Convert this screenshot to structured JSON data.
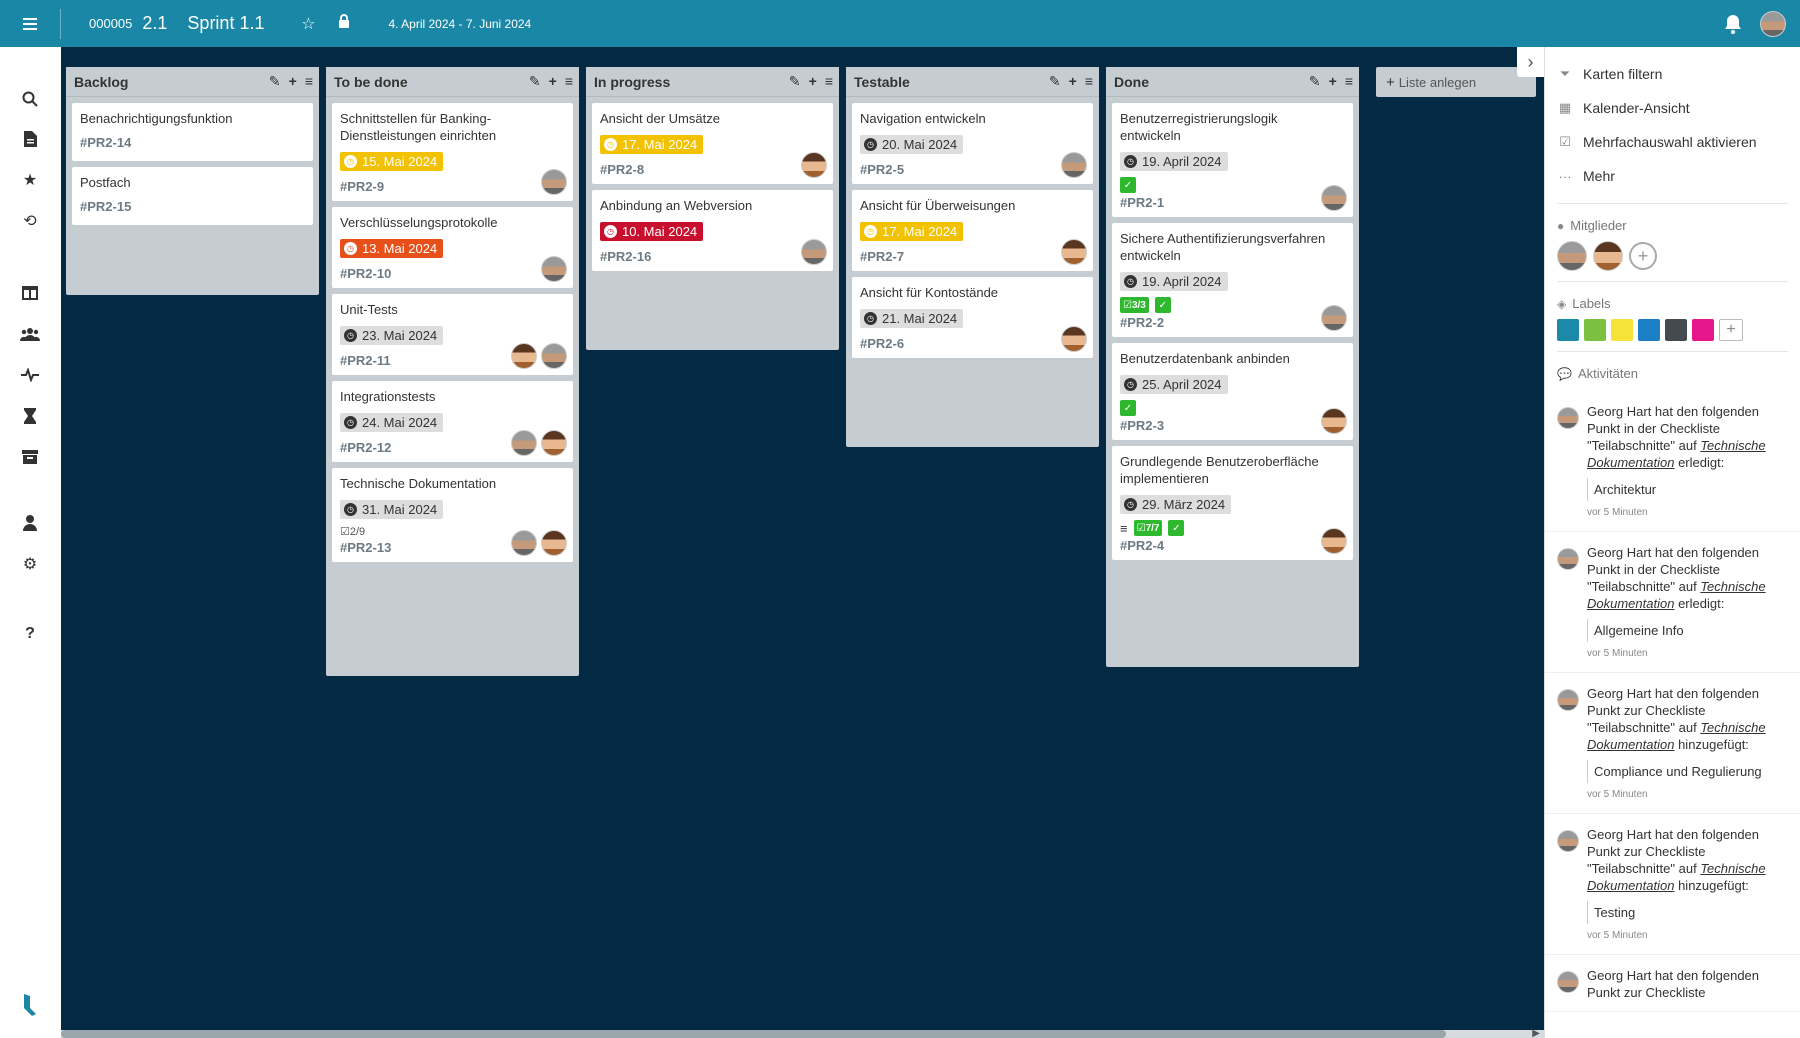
{
  "header": {
    "project_id": "000005",
    "project_version": "2.1",
    "sprint_name": "Sprint 1.1",
    "date_range": "4. April 2024 - 7. Juni 2024"
  },
  "columns": [
    {
      "title": "Backlog",
      "cards": [
        {
          "title": "Benachrichtigungsfunktion",
          "id": "#PR2-14"
        },
        {
          "title": "Postfach",
          "id": "#PR2-15"
        }
      ]
    },
    {
      "title": "To be done",
      "cards": [
        {
          "title": "Schnittstellen für Banking-Dienstleistungen einrichten",
          "date": "15. Mai 2024",
          "id": "#PR2-9"
        },
        {
          "title": "Verschlüsselungsprotokolle",
          "date": "13. Mai 2024",
          "id": "#PR2-10"
        },
        {
          "title": "Unit-Tests",
          "date": "23. Mai 2024",
          "id": "#PR2-11"
        },
        {
          "title": "Integrationstests",
          "date": "24. Mai 2024",
          "id": "#PR2-12"
        },
        {
          "title": "Technische Dokumentation",
          "date": "31. Mai 2024",
          "checklist": "2/9",
          "id": "#PR2-13"
        }
      ]
    },
    {
      "title": "In progress",
      "cards": [
        {
          "title": "Ansicht der Umsätze",
          "date": "17. Mai 2024",
          "id": "#PR2-8"
        },
        {
          "title": "Anbindung an Webversion",
          "date": "10. Mai 2024",
          "id": "#PR2-16"
        }
      ]
    },
    {
      "title": "Testable",
      "cards": [
        {
          "title": "Navigation entwickeln",
          "date": "20. Mai 2024",
          "id": "#PR2-5"
        },
        {
          "title": "Ansicht für Überweisungen",
          "date": "17. Mai 2024",
          "id": "#PR2-7"
        },
        {
          "title": "Ansicht für Kontostände",
          "date": "21. Mai 2024",
          "id": "#PR2-6"
        }
      ]
    },
    {
      "title": "Done",
      "cards": [
        {
          "title": "Benutzerregistrierungslogik entwickeln",
          "date": "19. April 2024",
          "id": "#PR2-1"
        },
        {
          "title": "Sichere Authentifizierungsverfahren entwickeln",
          "date": "19. April 2024",
          "checklist": "3/3",
          "id": "#PR2-2"
        },
        {
          "title": "Benutzerdatenbank anbinden",
          "date": "25. April 2024",
          "id": "#PR2-3"
        },
        {
          "title": "Grundlegende Benutzeroberfläche implementieren",
          "date": "29. März 2024",
          "checklist": "7/7",
          "id": "#PR2-4"
        }
      ]
    }
  ],
  "add_list_label": "Liste anlegen",
  "right_panel": {
    "menu": [
      {
        "label": "Karten filtern",
        "icon": "filter-icon"
      },
      {
        "label": "Kalender-Ansicht",
        "icon": "calendar-icon"
      },
      {
        "label": "Mehrfachauswahl aktivieren",
        "icon": "checkbox-icon"
      },
      {
        "label": "Mehr",
        "icon": "more-icon"
      }
    ],
    "members_title": "Mitglieder",
    "labels_title": "Labels",
    "label_colors": [
      "#1a8aa8",
      "#7ac142",
      "#f5e33a",
      "#1a7fc4",
      "#444b50",
      "#e8168c"
    ],
    "activities_title": "Aktivitäten",
    "activities": [
      {
        "line1": "Georg Hart hat den folgenden Punkt in der Checkliste \"Teilabschnitte\" auf",
        "link": "Technische Dokumentation",
        "verb": "erledigt:",
        "item": "Architektur",
        "time": "vor 5 Minuten"
      },
      {
        "line1": "Georg Hart hat den folgenden Punkt in der Checkliste \"Teilabschnitte\" auf",
        "link": "Technische Dokumentation",
        "verb": "erledigt:",
        "item": "Allgemeine Info",
        "time": "vor 5 Minuten"
      },
      {
        "line1": "Georg Hart hat den folgenden Punkt zur Checkliste \"Teilabschnitte\" auf",
        "link": "Technische Dokumentation",
        "verb": "hinzugefügt:",
        "item": "Compliance und Regulierung",
        "time": "vor 5 Minuten"
      },
      {
        "line1": "Georg Hart hat den folgenden Punkt zur Checkliste \"Teilabschnitte\" auf",
        "link": "Technische Dokumentation",
        "verb": "hinzugefügt:",
        "item": "Testing",
        "time": "vor 5 Minuten"
      },
      {
        "line1": "Georg Hart hat den folgenden Punkt zur Checkliste",
        "link": "",
        "verb": "",
        "item": "",
        "time": ""
      }
    ]
  },
  "colors": {
    "header": "#1a87a6",
    "board_bg": "#032a42",
    "column_bg": "#c6cdd2",
    "date_yellow": "#f2c200",
    "date_red": "#c8102e",
    "date_orange": "#e8501a",
    "check_green": "#2eb82e"
  }
}
